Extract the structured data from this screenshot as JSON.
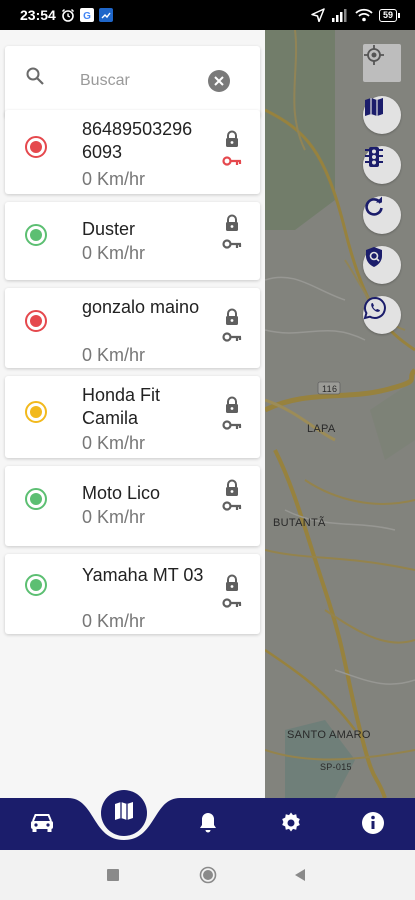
{
  "status_bar": {
    "time": "23:54",
    "battery": "59",
    "icons": [
      "alarm-icon",
      "google-icon",
      "app-icon",
      "location-arrow-icon",
      "signal-icon",
      "wifi-icon",
      "battery-icon"
    ]
  },
  "search": {
    "placeholder": "Buscar"
  },
  "vehicles": [
    {
      "name": "86489503296 6093",
      "speed": "0 Km/hr",
      "status_color": "#e5484d",
      "key_color": "#e5484d"
    },
    {
      "name": "Duster",
      "speed": "0 Km/hr",
      "status_color": "#5cbf72",
      "key_color": "#5f5f5f"
    },
    {
      "name": "gonzalo maino",
      "speed": "0 Km/hr",
      "status_color": "#e5484d",
      "key_color": "#5f5f5f"
    },
    {
      "name": "Honda Fit Camila",
      "speed": "0 Km/hr",
      "status_color": "#f2b91d",
      "key_color": "#5f5f5f"
    },
    {
      "name": "Moto Lico",
      "speed": "0 Km/hr",
      "status_color": "#5cbf72",
      "key_color": "#5f5f5f"
    },
    {
      "name": "Yamaha MT 03",
      "speed": "0 Km/hr",
      "status_color": "#5cbf72",
      "key_color": "#5f5f5f"
    }
  ],
  "map": {
    "labels": {
      "lapa": "LAPA",
      "butanta": "BUTANTÃ",
      "santo_amaro": "SANTO AMARO",
      "road_116": "116",
      "sp015": "SP-015"
    },
    "buttons": [
      "my-location-icon",
      "map-layers-icon",
      "traffic-light-icon",
      "refresh-icon",
      "shield-icon",
      "whatsapp-icon"
    ]
  },
  "bottom_nav": {
    "items": [
      "car-icon",
      "map-icon",
      "bell-icon",
      "gear-icon",
      "info-icon"
    ],
    "active": "map-icon",
    "color": "#1b1d6b"
  },
  "system_nav": [
    "recents-square-icon",
    "home-circle-icon",
    "back-triangle-icon"
  ]
}
